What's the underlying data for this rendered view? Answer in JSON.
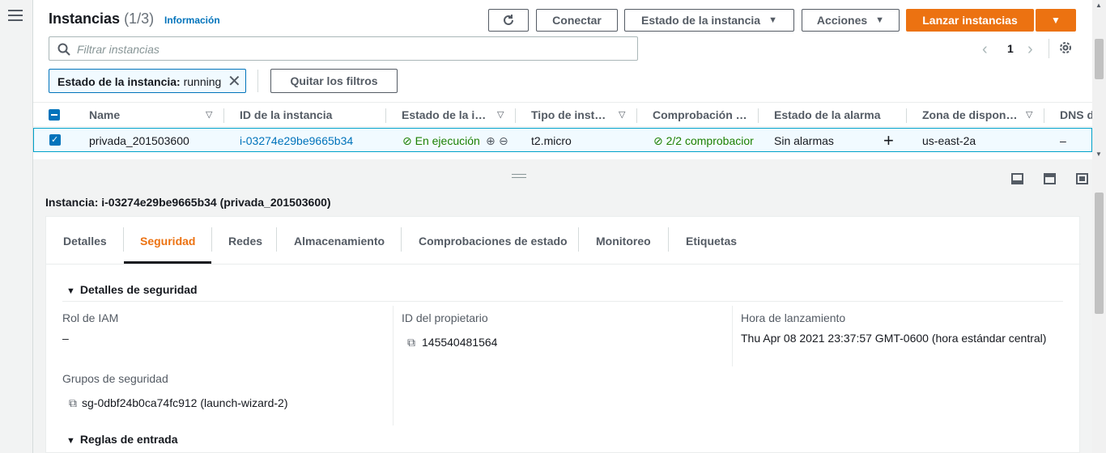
{
  "header": {
    "title": "Instancias",
    "count": "(1/3)",
    "info_link": "Información",
    "refresh_icon": "refresh-icon",
    "connect_label": "Conectar",
    "instance_state_label": "Estado de la instancia",
    "actions_label": "Acciones",
    "launch_label": "Lanzar instancias"
  },
  "search": {
    "placeholder": "Filtrar instancias"
  },
  "pagination": {
    "page": "1"
  },
  "filter": {
    "chip_key": "Estado de la instancia:",
    "chip_value": "running",
    "clear_label": "Quitar los filtros"
  },
  "table": {
    "columns": [
      "Name",
      "ID de la instancia",
      "Estado de la i…",
      "Tipo de inst…",
      "Comprobación …",
      "Estado de la alarma",
      "Zona de dispon…",
      "DNS d"
    ],
    "rows": [
      {
        "name": "privada_201503600",
        "id": "i-03274e29be9665b34",
        "state": "En ejecución",
        "type": "t2.micro",
        "checks": "2/2 comprobacior",
        "alarm": "Sin alarmas",
        "zone": "us-east-2a",
        "dns": "–"
      }
    ]
  },
  "detail": {
    "instance_title": "Instancia: i-03274e29be9665b34 (privada_201503600)",
    "tabs": [
      "Detalles",
      "Seguridad",
      "Redes",
      "Almacenamiento",
      "Comprobaciones de estado",
      "Monitoreo",
      "Etiquetas"
    ],
    "active_tab": "Seguridad",
    "security_section": "Detalles de seguridad",
    "iam_role_label": "Rol de IAM",
    "iam_role_value": "–",
    "owner_id_label": "ID del propietario",
    "owner_id_value": "145540481564",
    "launch_time_label": "Hora de lanzamiento",
    "launch_time_value": "Thu Apr 08 2021 23:37:57 GMT-0600 (hora estándar central)",
    "security_groups_label": "Grupos de seguridad",
    "security_group_value": "sg-0dbf24b0ca74fc912 (launch-wizard-2)",
    "inbound_rules_section": "Reglas de entrada"
  },
  "colors": {
    "accent": "#ec7211",
    "link": "#0073bb",
    "success": "#1d8102"
  }
}
